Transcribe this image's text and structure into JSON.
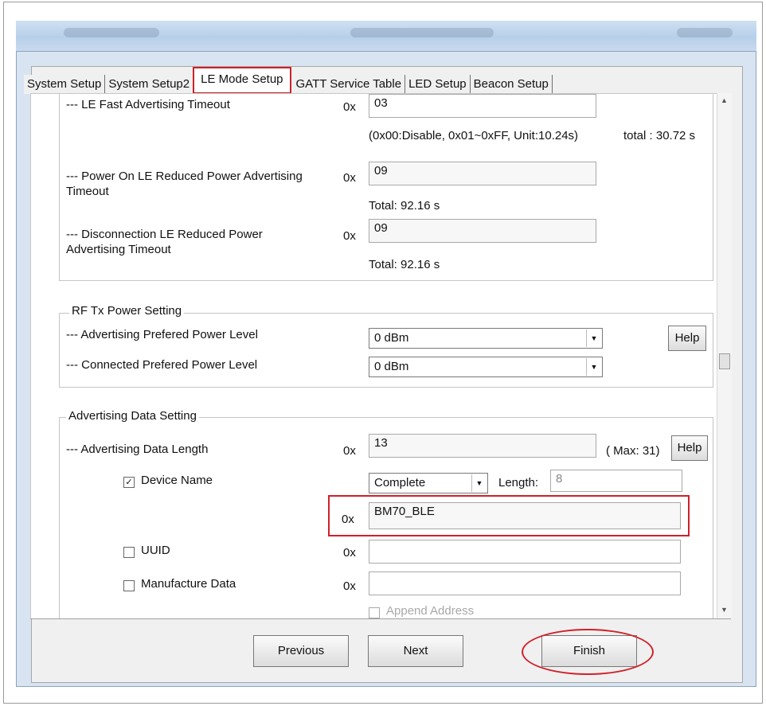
{
  "tabs": [
    {
      "label": "System Setup"
    },
    {
      "label": "System Setup2"
    },
    {
      "label": "LE Mode Setup"
    },
    {
      "label": "GATT Service Table"
    },
    {
      "label": "LED Setup"
    },
    {
      "label": "Beacon Setup"
    }
  ],
  "advertising_timeouts": {
    "fast_label": "--- LE Fast Advertising Timeout",
    "prefix": "0x",
    "fast_value": "03",
    "fast_hint": "(0x00:Disable,  0x01~0xFF, Unit:10.24s)",
    "fast_total": "total : 30.72 s",
    "power_on_label_1": "--- Power On LE Reduced Power Advertising",
    "power_on_label_2": "Timeout",
    "power_on_value": "09",
    "power_on_total": "Total: 92.16 s",
    "disconnection_label_1": "--- Disconnection LE Reduced Power",
    "disconnection_label_2": "Advertising Timeout",
    "disconnection_value": "09",
    "disconnection_total": "Total: 92.16 s"
  },
  "rf_tx": {
    "title": "RF Tx Power Setting",
    "adv_label": "--- Advertising Prefered Power Level",
    "adv_value": "0 dBm",
    "conn_label": "--- Connected Prefered Power Level",
    "conn_value": "0 dBm",
    "help_label": "Help"
  },
  "adv_data": {
    "title": "Advertising Data Setting",
    "length_label": "--- Advertising Data Length",
    "prefix": "0x",
    "length_value": "13",
    "max_label": "( Max: 31)",
    "help_label": "Help",
    "device_name_label": "Device Name",
    "device_name_checked": "✓",
    "name_type": "Complete",
    "length_text": "Length:",
    "length_num": "8",
    "device_name_value": "BM70_BLE",
    "uuid_label": "UUID",
    "manufacture_label": "Manufacture Data",
    "append_label": "Append Address"
  },
  "buttons": {
    "previous": "Previous",
    "next": "Next",
    "finish": "Finish"
  },
  "colors": {
    "highlight": "#d0202a"
  }
}
